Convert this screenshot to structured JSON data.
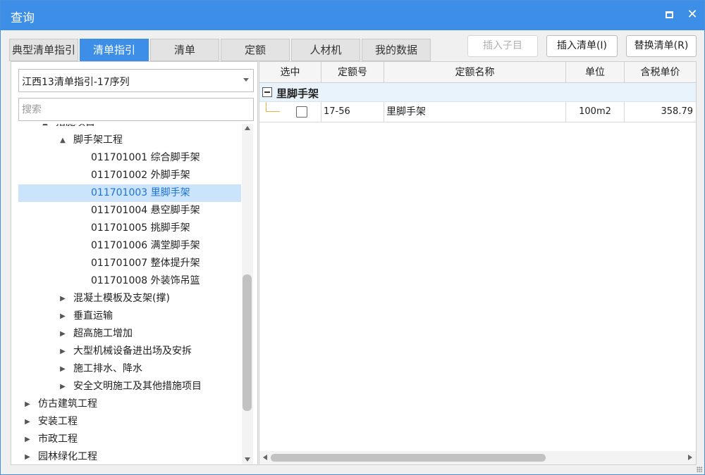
{
  "window": {
    "title": "查询",
    "maximize_icon": "maximize-icon",
    "close_symbol": "✕"
  },
  "tabs": [
    {
      "label": "典型清单指引",
      "active": false
    },
    {
      "label": "清单指引",
      "active": true
    },
    {
      "label": "清单",
      "active": false
    },
    {
      "label": "定额",
      "active": false
    },
    {
      "label": "人材机",
      "active": false
    },
    {
      "label": "我的数据",
      "active": false
    }
  ],
  "toolbar": {
    "insert_child": "插入子目",
    "insert_list": "插入清单(I)",
    "replace_list": "替换清单(R)"
  },
  "left": {
    "select_value": "江西13清单指引-17序列",
    "search_placeholder": "搜索",
    "tree": [
      {
        "label": "措施项目",
        "expander": "▲"
      },
      {
        "label": "脚手架工程",
        "expander": "▲"
      },
      {
        "label": "011701001  综合脚手架",
        "expander": ""
      },
      {
        "label": "011701002  外脚手架",
        "expander": ""
      },
      {
        "label": "011701003  里脚手架",
        "expander": "",
        "selected": true
      },
      {
        "label": "011701004  悬空脚手架",
        "expander": ""
      },
      {
        "label": "011701005  挑脚手架",
        "expander": ""
      },
      {
        "label": "011701006  满堂脚手架",
        "expander": ""
      },
      {
        "label": "011701007  整体提升架",
        "expander": ""
      },
      {
        "label": "011701008  外装饰吊篮",
        "expander": ""
      },
      {
        "label": "混凝土模板及支架(撑)",
        "expander": "▶"
      },
      {
        "label": "垂直运输",
        "expander": "▶"
      },
      {
        "label": "超高施工增加",
        "expander": "▶"
      },
      {
        "label": "大型机械设备进出场及安拆",
        "expander": "▶"
      },
      {
        "label": "施工排水、降水",
        "expander": "▶"
      },
      {
        "label": "安全文明施工及其他措施项目",
        "expander": "▶"
      },
      {
        "label": "仿古建筑工程",
        "expander": "▶"
      },
      {
        "label": "安装工程",
        "expander": "▶"
      },
      {
        "label": "市政工程",
        "expander": "▶"
      },
      {
        "label": "园林绿化工程",
        "expander": "▶"
      }
    ]
  },
  "table": {
    "headers": [
      "选中",
      "定额号",
      "定额名称",
      "单位",
      "含税单价"
    ],
    "group_label": "里脚手架",
    "rows": [
      {
        "checked": false,
        "code": "17-56",
        "name": "里脚手架",
        "unit": "100m2",
        "price": "358.79"
      }
    ]
  },
  "colors": {
    "accent": "#3c8ee6",
    "selected_bg": "#cce4fb",
    "selected_text": "#1a74d8"
  }
}
